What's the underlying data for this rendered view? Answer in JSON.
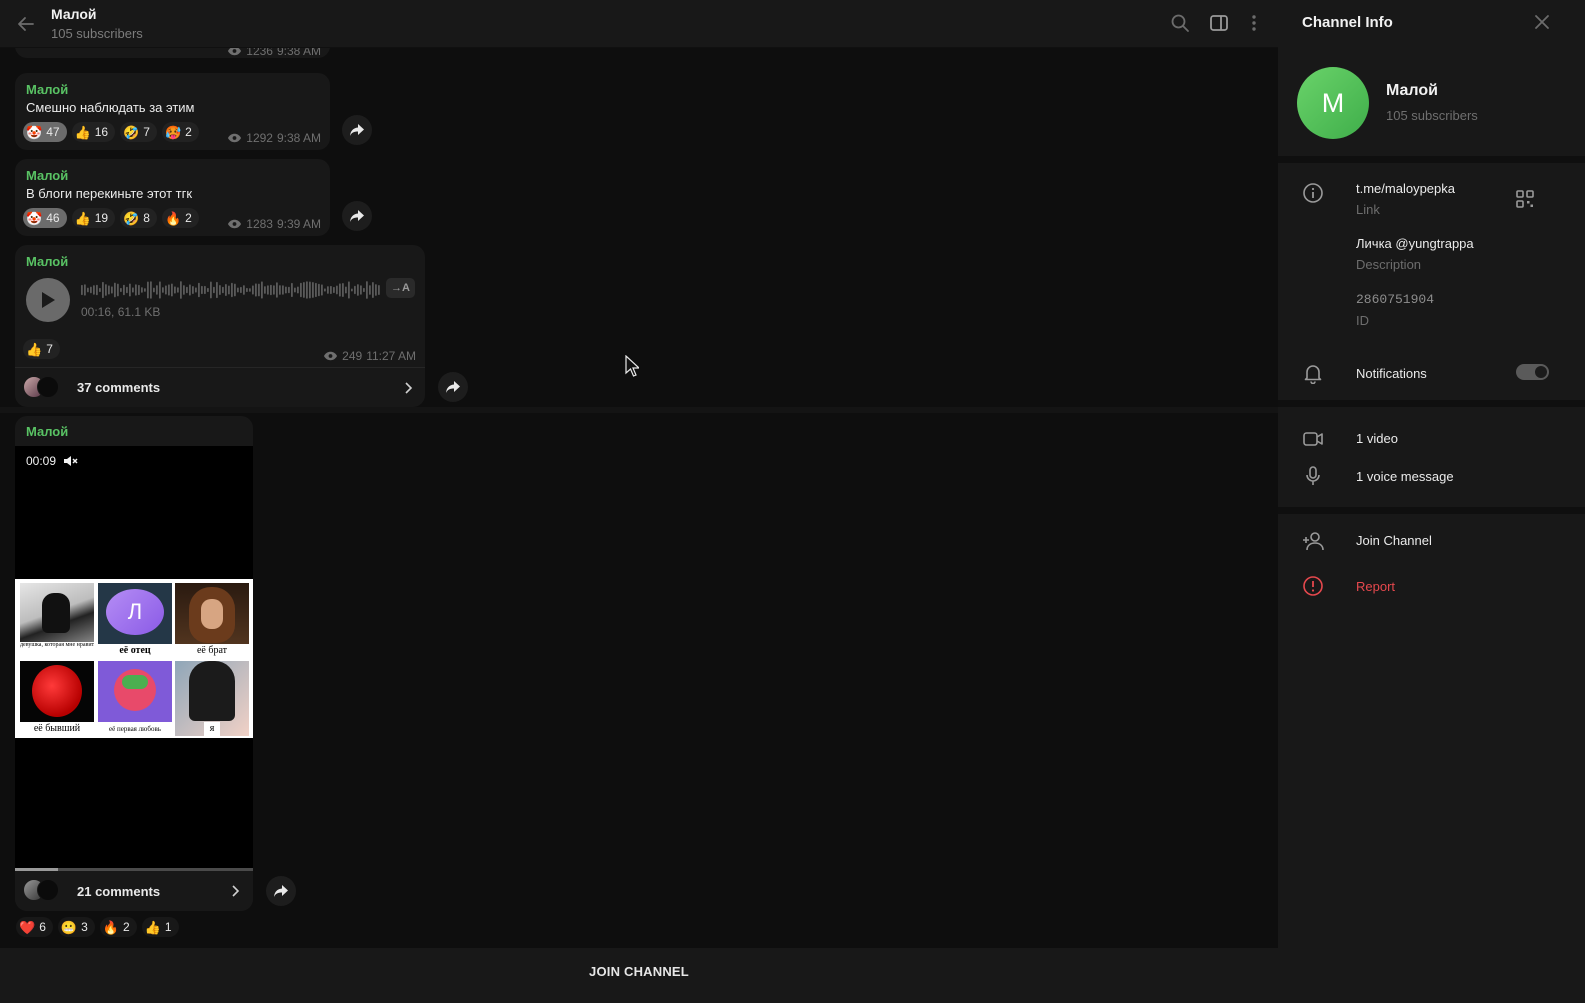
{
  "header": {
    "title": "Малой",
    "subtitle": "105 subscribers"
  },
  "messages": [
    {
      "author": "Малой",
      "text": "Смешно наблюдать за этим",
      "reactions": [
        {
          "emoji": "🤡",
          "count": "47",
          "selected": true
        },
        {
          "emoji": "👍",
          "count": "16"
        },
        {
          "emoji": "🤣",
          "count": "7"
        },
        {
          "emoji": "🥵",
          "count": "2"
        }
      ],
      "views": "1292",
      "time": "9:38 AM"
    },
    {
      "author": "Малой",
      "text": "В блоги перекиньте этот тгк",
      "reactions": [
        {
          "emoji": "🤡",
          "count": "46",
          "selected": true
        },
        {
          "emoji": "👍",
          "count": "19"
        },
        {
          "emoji": "🤣",
          "count": "8"
        },
        {
          "emoji": "🔥",
          "count": "2"
        }
      ],
      "views": "1283",
      "time": "9:39 AM"
    },
    {
      "author": "Малой",
      "voice": {
        "info": "00:16, 61.1 KB",
        "transcribe": "→A"
      },
      "reactions": [
        {
          "emoji": "👍",
          "count": "7"
        }
      ],
      "views": "249",
      "time": "11:27 AM",
      "comments": "37 comments"
    },
    {
      "author": "Малой",
      "video": {
        "time": "00:09",
        "progress": 0.18,
        "captions": [
          "девушка, которая мне нравится",
          "её отец",
          "её брат",
          "её бывший",
          "её первая любовь",
          "я"
        ],
        "avatar_letter": "Л"
      },
      "comments": "21 comments",
      "reactions": [
        {
          "emoji": "❤️",
          "count": "6"
        },
        {
          "emoji": "😬",
          "count": "3"
        },
        {
          "emoji": "🔥",
          "count": "2"
        },
        {
          "emoji": "👍",
          "count": "1"
        }
      ]
    }
  ],
  "partial_top": {
    "views": "1236",
    "time": "9:38 AM"
  },
  "bottom": {
    "join_label": "JOIN CHANNEL"
  },
  "panel": {
    "title": "Channel Info",
    "avatar_letter": "M",
    "name": "Малой",
    "subscribers": "105 subscribers",
    "link": "t.me/maloypepka",
    "link_label": "Link",
    "description": "Личка @yungtrappa",
    "description_label": "Description",
    "id": "2860751904",
    "id_label": "ID",
    "notifications_label": "Notifications",
    "notifications_on": true,
    "media": [
      {
        "label": "1 video"
      },
      {
        "label": "1 voice message"
      }
    ],
    "join_label": "Join Channel",
    "report_label": "Report"
  },
  "colors": {
    "accent_green": "#59c264",
    "report_red": "#e5484d",
    "background": "#0e0e0e",
    "panel": "#181818"
  }
}
